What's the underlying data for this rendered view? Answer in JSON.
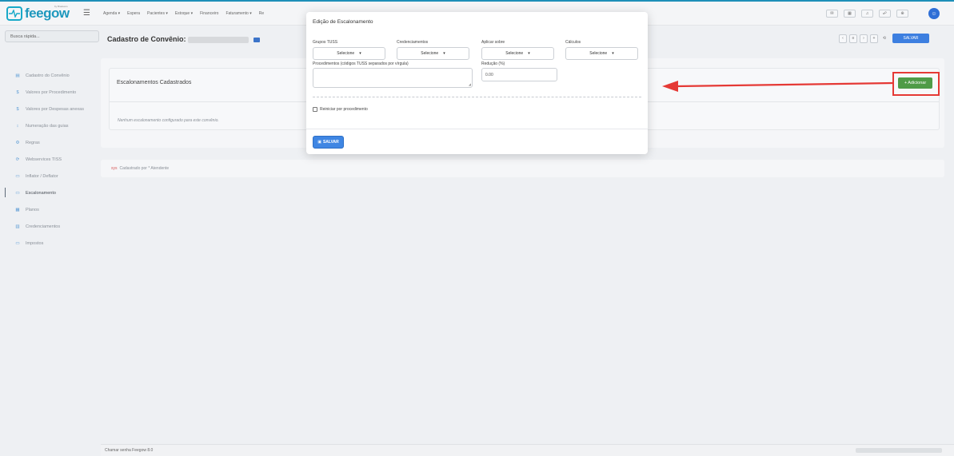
{
  "app": {
    "logo_text": "feegow",
    "logo_sub": "by Bradesco"
  },
  "topnav": {
    "items": [
      "Agenda ▾",
      "Espera",
      "Pacientes ▾",
      "Estoque ▾",
      "Financeiro",
      "Faturamento ▾",
      "Re"
    ]
  },
  "search": {
    "placeholder": "Busca rápida..."
  },
  "sidebar": {
    "items": [
      {
        "label": "Cadastro do Convênio",
        "icon": "▤"
      },
      {
        "label": "Valores por Procedimento",
        "icon": "$"
      },
      {
        "label": "Valores por Despesas anexas",
        "icon": "$"
      },
      {
        "label": "Numeração das guias",
        "icon": "↕"
      },
      {
        "label": "Regras",
        "icon": "⚙"
      },
      {
        "label": "Webservices TISS",
        "icon": "⟳"
      },
      {
        "label": "Inflator / Deflator",
        "icon": "▭"
      },
      {
        "label": "Escalonamento",
        "icon": "▭"
      },
      {
        "label": "Planos",
        "icon": "▦"
      },
      {
        "label": "Credenciamentos",
        "icon": "▥"
      },
      {
        "label": "Impostos",
        "icon": "▭"
      }
    ]
  },
  "page": {
    "title": "Cadastro de Convênio:",
    "save_label": "SALVAR"
  },
  "escalonamentos": {
    "title": "Escalonamentos Cadastrados",
    "add_label": "+ Adicionar",
    "empty_text": "Nenhum escalonamento configurado para este convênio."
  },
  "footer": {
    "tag": "sys",
    "text": "Cadastrado por * Atendente"
  },
  "bottom": {
    "text": "Chamar senha  Feegow 8.0"
  },
  "modal": {
    "title": "Edição de Escalonamento",
    "grupos_label": "Grupos TUSS",
    "credenciamentos_label": "Credenciamentos",
    "aplicar_label": "Aplicar sobre",
    "calculos_label": "Cálculos",
    "select_placeholder": "Selecione",
    "procedimentos_label": "Procedimentos (códigos TUSS separados por vírgula)",
    "reducao_label": "Redução (%)",
    "reducao_value": "0.00",
    "reiniciar_label": "Reiniciar por procedimento",
    "save_label": "SALVAR"
  },
  "colors": {
    "accent": "#3f86e3",
    "add_button": "#4f9b47",
    "highlight": "#e53935"
  }
}
